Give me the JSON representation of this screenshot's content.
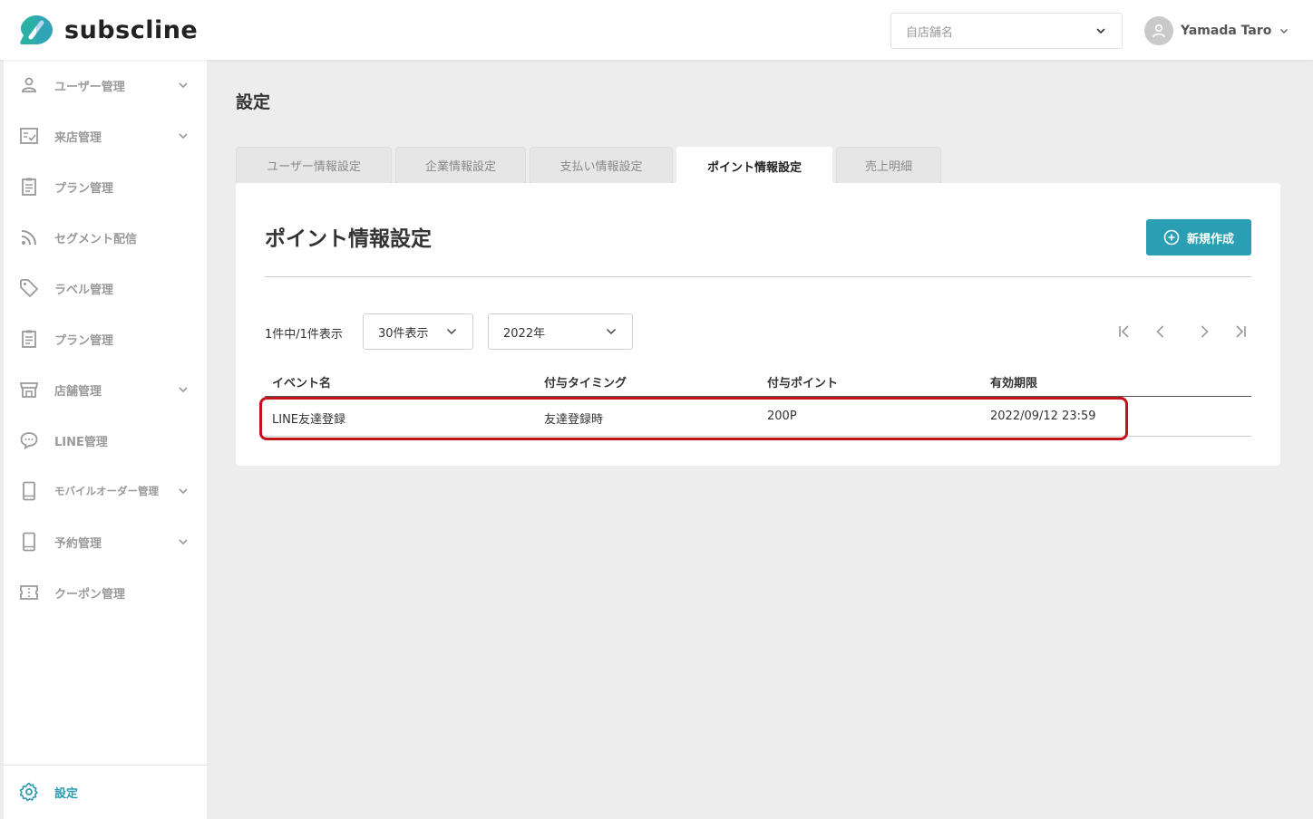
{
  "header": {
    "brand": "subscline",
    "store_select_placeholder": "自店舗名",
    "user_name": "Yamada Taro",
    "accent_color": "#2a9fb3"
  },
  "sidebar": {
    "items": [
      {
        "label": "ユーザー管理",
        "icon": "user-icon",
        "has_chevron": true
      },
      {
        "label": "来店管理",
        "icon": "checkin-icon",
        "has_chevron": true
      },
      {
        "label": "プラン管理",
        "icon": "clipboard-icon",
        "has_chevron": false
      },
      {
        "label": "セグメント配信",
        "icon": "rss-icon",
        "has_chevron": false
      },
      {
        "label": "ラベル管理",
        "icon": "tag-icon",
        "has_chevron": false
      },
      {
        "label": "プラン管理",
        "icon": "clipboard-icon",
        "has_chevron": false
      },
      {
        "label": "店舗管理",
        "icon": "store-icon",
        "has_chevron": true
      },
      {
        "label": "LINE管理",
        "icon": "chat-icon",
        "has_chevron": false
      },
      {
        "label": "モバイルオーダー管理",
        "icon": "mobile-icon",
        "has_chevron": true
      },
      {
        "label": "予約管理",
        "icon": "mobile-icon",
        "has_chevron": true
      },
      {
        "label": "クーポン管理",
        "icon": "ticket-icon",
        "has_chevron": false
      }
    ],
    "settings_label": "設定"
  },
  "main": {
    "page_title": "設定",
    "tabs": [
      {
        "label": "ユーザー情報設定",
        "active": false
      },
      {
        "label": "企業情報設定",
        "active": false
      },
      {
        "label": "支払い情報設定",
        "active": false
      },
      {
        "label": "ポイント情報設定",
        "active": true
      },
      {
        "label": "売上明細",
        "active": false
      }
    ],
    "card": {
      "title": "ポイント情報設定",
      "new_button_label": "新規作成",
      "count_text": "1件中/1件表示",
      "per_page_select": "30件表示",
      "year_select": "2022年",
      "columns": [
        "イベント名",
        "付与タイミング",
        "付与ポイント",
        "有効期限"
      ],
      "rows": [
        {
          "event_name": "LINE友達登録",
          "timing": "友達登録時",
          "points": "200P",
          "expiry": "2022/09/12 23:59"
        }
      ],
      "highlight_color": "#c4121a"
    }
  }
}
